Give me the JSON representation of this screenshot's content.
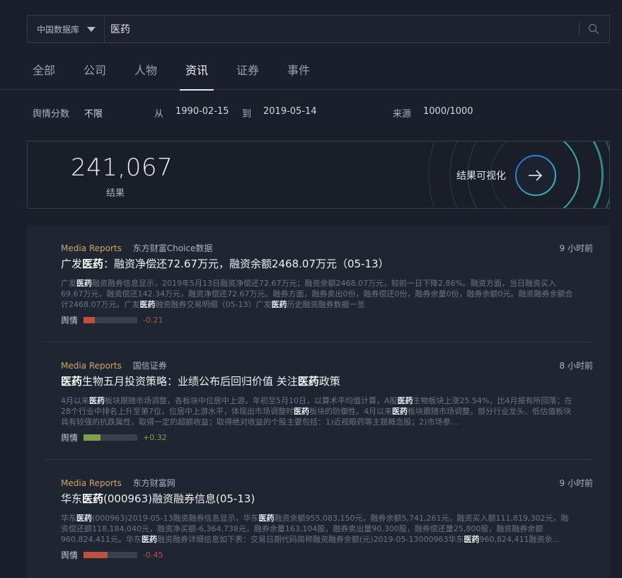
{
  "search": {
    "database": "中国数据库",
    "query": "医药"
  },
  "tabs": [
    {
      "label": "全部"
    },
    {
      "label": "公司"
    },
    {
      "label": "人物"
    },
    {
      "label": "资讯"
    },
    {
      "label": "证券"
    },
    {
      "label": "事件"
    }
  ],
  "active_tab": "资讯",
  "filters": {
    "score_label": "舆情分数",
    "score_value": "不限",
    "from_label": "从",
    "from_value": "1990-02-15",
    "to_label": "到",
    "to_value": "2019-05-14",
    "source_label": "来源",
    "source_value": "1000/1000"
  },
  "summary": {
    "count": "241,067",
    "count_label": "结果",
    "visualize_label": "结果可视化"
  },
  "results": [
    {
      "category": "Media Reports",
      "source": "东方财富Choice数据",
      "time": "9 小时前",
      "title_pre": "广发",
      "title_kw": "医药",
      "title_post": "：融资净偿还72.67万元，融资余额2468.07万元（05-13）",
      "s1": "广发",
      "k1": "医药",
      "s2": "融资融券信息显示，2019年5月13日融资净偿还72.67万元；融资余额2468.07万元，较前一日下降2.86%。融资方面，当日融资买入69.67万元，融资偿还142.34万元，融资净偿还72.67万元。融券方面，融券卖出0份，融券偿还0份，融券余量0份，融券余额0元。融资融券余额合计2468.07万元。广发",
      "k2": "医药",
      "s3": "融资融券交易明细（05-13）广发",
      "k3": "医药",
      "s4": "历史融资融券数据一览",
      "sentiment_label": "舆情",
      "sentiment_value": "-0.21",
      "sentiment_level": 0.21,
      "sentiment_color": "#c0503e"
    },
    {
      "category": "Media Reports",
      "source": "国信证券",
      "time": "8 小时前",
      "title_pre": "",
      "title_kw": "医药",
      "title_post": "生物五月投资策略：业绩公布后回归价值 关注",
      "title_kw2": "医药",
      "title_post2": "政策",
      "s1": "4月以来",
      "k1": "医药",
      "s2": "板块跟随市场调整，各板块中位居中上游。年初至5月10日，以算术平均值计算，A股",
      "k2": "医药",
      "s3": "生物板块上涨25.54%，比4月报有所回落；在28个行业中排名上升至第7位，位居中上游水平，体现出市场调整时",
      "k3": "医药",
      "s4": "板块的防御性。4月以来",
      "k4": "医药",
      "s5": "板块跟随市场调整，部分行业龙头、低估值板块具有较强的抗跌属性，取得一定的超额收益；取得绝对收益的个股主要包括：1)近视眼药等主题概念股；2)市场参...",
      "sentiment_label": "舆情",
      "sentiment_value": "+0.32",
      "sentiment_level": 0.32,
      "sentiment_color": "#7ea04a"
    },
    {
      "category": "Media Reports",
      "source": "东方财富网",
      "time": "9 小时前",
      "title_pre": "华东",
      "title_kw": "医药",
      "title_post": "(000963)融资融券信息(05-13)",
      "s1": "华东",
      "k1": "医药",
      "s2": "(000963)2019-05-13融资融券信息显示，华东",
      "k2": "医药",
      "s3": "融资余额955,083,150元，融券余额5,741,261元，融资买入额111,819,302元，融资偿还额118,184,040元，融资净买额-6,364,738元，融券余量163,104股，融券卖出量90,300股，融券偿还量25,800股，融资融券余额960,824,411元。华东",
      "k3": "医药",
      "s4": "融资融券详细信息如下表：交易日期代码简称融资融券余额(元)2019-05-13000963华东",
      "k4": "医药",
      "s5": "960,824,411融资余...",
      "sentiment_label": "舆情",
      "sentiment_value": "-0.45",
      "sentiment_level": 0.45,
      "sentiment_color": "#c0503e"
    }
  ]
}
